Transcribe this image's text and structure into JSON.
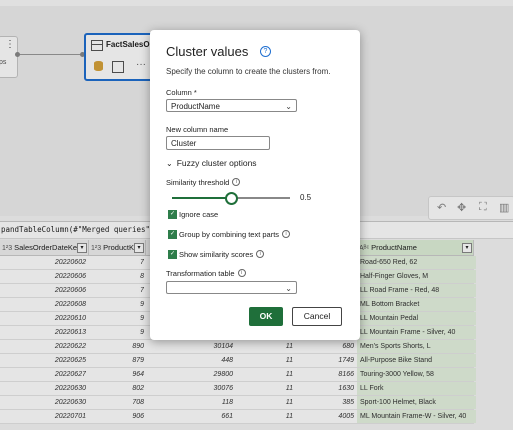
{
  "canvas": {
    "left_node_label": "ps",
    "main_node_title": "FactSalesOrd"
  },
  "formula_bar": {
    "text": "pandTableColumn(#\"Merged queries\","
  },
  "grid": {
    "columns": [
      {
        "type": "1²3",
        "name": "SalesOrderDateKey"
      },
      {
        "type": "1²3",
        "name": "ProductKey"
      },
      {
        "type": "",
        "name": ""
      },
      {
        "type": "",
        "name": ""
      },
      {
        "type": "",
        "name": ""
      },
      {
        "type": "Aᴮᶜ",
        "name": "ProductName"
      }
    ],
    "rows": [
      [
        "20220602",
        "7",
        "",
        "",
        "",
        "Road-650 Red, 62"
      ],
      [
        "20220606",
        "8",
        "",
        "",
        "",
        "Half-Finger Gloves, M"
      ],
      [
        "20220606",
        "7",
        "",
        "",
        "",
        "LL Road Frame - Red, 48"
      ],
      [
        "20220608",
        "9",
        "",
        "",
        "",
        "ML Bottom Bracket"
      ],
      [
        "20220610",
        "9",
        "",
        "",
        "",
        "LL Mountain Pedal"
      ],
      [
        "20220613",
        "9",
        "",
        "",
        "",
        "LL Mountain Frame - Silver, 40"
      ],
      [
        "20220622",
        "890",
        "30104",
        "11",
        "680",
        "Men's Sports Shorts, L"
      ],
      [
        "20220625",
        "879",
        "448",
        "11",
        "1749",
        "All-Purpose Bike Stand"
      ],
      [
        "20220627",
        "964",
        "29800",
        "11",
        "8166",
        "Touring-3000 Yellow, 58"
      ],
      [
        "20220630",
        "802",
        "30076",
        "11",
        "1630",
        "LL Fork"
      ],
      [
        "20220630",
        "708",
        "118",
        "11",
        "385",
        "Sport-100 Helmet, Black"
      ],
      [
        "20220701",
        "906",
        "661",
        "11",
        "4005",
        "ML Mountain Frame-W - Silver, 40"
      ]
    ]
  },
  "dialog": {
    "title": "Cluster values",
    "description": "Specify the column to create the clusters from.",
    "column_label": "Column *",
    "column_value": "ProductName",
    "new_column_label": "New column name",
    "new_column_value": "Cluster",
    "fuzzy_section": "Fuzzy cluster options",
    "similarity_label": "Similarity threshold",
    "similarity_value": "0.5",
    "similarity_fraction": 0.5,
    "options": [
      {
        "label": "Ignore case",
        "checked": true
      },
      {
        "label": "Group by combining text parts",
        "checked": true,
        "info": true
      },
      {
        "label": "Show similarity scores",
        "checked": true,
        "info": true
      }
    ],
    "transformation_label": "Transformation table",
    "transformation_value": "",
    "ok_label": "OK",
    "cancel_label": "Cancel"
  },
  "colors": {
    "accent_green": "#1f6f3a",
    "selection_blue": "#1f6fd1",
    "highlight_column": "#dff0d8"
  }
}
